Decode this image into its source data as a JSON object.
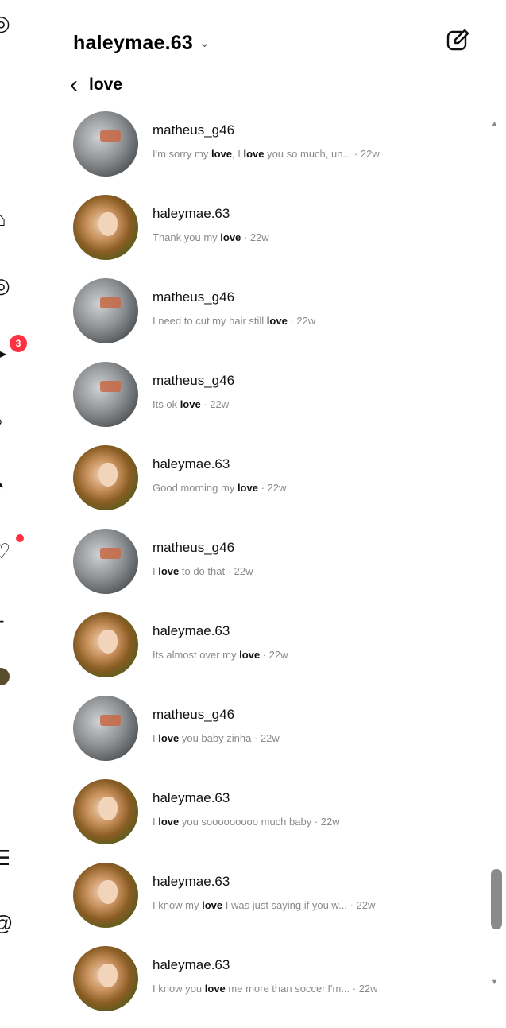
{
  "header": {
    "title": "haleymae.63",
    "chevron": "⌄"
  },
  "search": {
    "query": "love"
  },
  "left_rail": {
    "notification_badge": "3"
  },
  "results": [
    {
      "name": "matheus_g46",
      "avatar": "matheus",
      "parts": [
        {
          "t": "I'm sorry my "
        },
        {
          "b": "love"
        },
        {
          "t": ", I "
        },
        {
          "b": "love"
        },
        {
          "t": " you so much, un... · 22w"
        }
      ]
    },
    {
      "name": "haleymae.63",
      "avatar": "haley",
      "parts": [
        {
          "t": "Thank you my "
        },
        {
          "b": "love"
        },
        {
          "t": " · 22w"
        }
      ]
    },
    {
      "name": "matheus_g46",
      "avatar": "matheus",
      "parts": [
        {
          "t": "I need to cut my hair still "
        },
        {
          "b": "love"
        },
        {
          "t": " · 22w"
        }
      ]
    },
    {
      "name": "matheus_g46",
      "avatar": "matheus",
      "parts": [
        {
          "t": "Its ok "
        },
        {
          "b": "love"
        },
        {
          "t": " · 22w"
        }
      ]
    },
    {
      "name": "haleymae.63",
      "avatar": "haley",
      "parts": [
        {
          "t": "Good morning my "
        },
        {
          "b": "love"
        },
        {
          "t": " · 22w"
        }
      ]
    },
    {
      "name": "matheus_g46",
      "avatar": "matheus",
      "parts": [
        {
          "t": "I "
        },
        {
          "b": "love"
        },
        {
          "t": " to do that · 22w"
        }
      ]
    },
    {
      "name": "haleymae.63",
      "avatar": "haley",
      "parts": [
        {
          "t": "Its almost over my "
        },
        {
          "b": "love"
        },
        {
          "t": " · 22w"
        }
      ]
    },
    {
      "name": "matheus_g46",
      "avatar": "matheus",
      "parts": [
        {
          "t": "I "
        },
        {
          "b": "love"
        },
        {
          "t": " you baby zinha · 22w"
        }
      ]
    },
    {
      "name": "haleymae.63",
      "avatar": "haley",
      "parts": [
        {
          "t": "I "
        },
        {
          "b": "love"
        },
        {
          "t": " you sooooooooo much baby · 22w"
        }
      ]
    },
    {
      "name": "haleymae.63",
      "avatar": "haley",
      "parts": [
        {
          "t": "I know my "
        },
        {
          "b": "love"
        },
        {
          "t": " I was just saying if you w... · 22w"
        }
      ]
    },
    {
      "name": "haleymae.63",
      "avatar": "haley",
      "parts": [
        {
          "t": "I know you "
        },
        {
          "b": "love"
        },
        {
          "t": " me more than soccer.I'm... · 22w"
        }
      ]
    }
  ],
  "icons": {
    "compose": "compose-icon",
    "back": "chevron-left-icon",
    "scroll_up": "scroll-up-arrow",
    "scroll_down": "scroll-down-arrow"
  }
}
